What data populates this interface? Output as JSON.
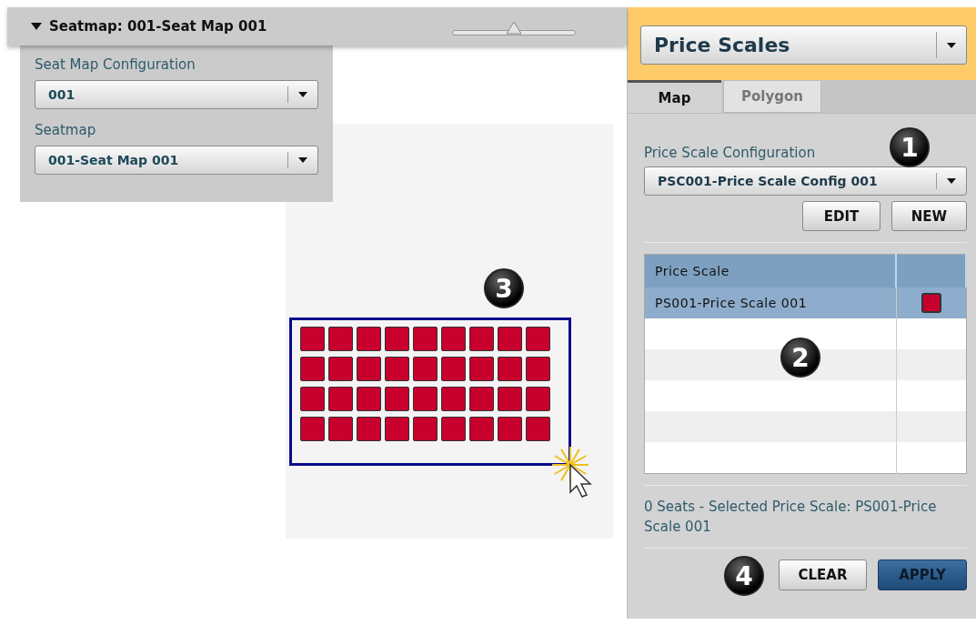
{
  "seatmap_bar": {
    "title": "Seatmap: 001-Seat Map 001",
    "expanded": true,
    "zoom_slider": {
      "level": 0.5
    }
  },
  "seatmap_settings": {
    "fields": [
      {
        "label": "Seat Map Configuration",
        "value": "001"
      },
      {
        "label": "Seatmap",
        "value": "001-Seat Map 001"
      }
    ]
  },
  "seat_map": {
    "callout": "3",
    "seat_rows": [
      {
        "seats": [
          {
            "color": "#c8002e"
          },
          {
            "color": "#c8002e"
          },
          {
            "color": "#c8002e"
          },
          {
            "color": "#c8002e"
          },
          {
            "color": "#c8002e"
          },
          {
            "color": "#c8002e"
          },
          {
            "color": "#c8002e"
          },
          {
            "color": "#c8002e"
          },
          {
            "color": "#c8002e"
          }
        ]
      },
      {
        "seats": [
          {
            "color": "#c8002e"
          },
          {
            "color": "#c8002e"
          },
          {
            "color": "#c8002e"
          },
          {
            "color": "#c8002e"
          },
          {
            "color": "#c8002e"
          },
          {
            "color": "#c8002e"
          },
          {
            "color": "#c8002e"
          },
          {
            "color": "#c8002e"
          },
          {
            "color": "#c8002e"
          }
        ]
      },
      {
        "seats": [
          {
            "color": "#c8002e"
          },
          {
            "color": "#c8002e"
          },
          {
            "color": "#c8002e"
          },
          {
            "color": "#c8002e"
          },
          {
            "color": "#c8002e"
          },
          {
            "color": "#c8002e"
          },
          {
            "color": "#c8002e"
          },
          {
            "color": "#c8002e"
          },
          {
            "color": "#c8002e"
          }
        ]
      },
      {
        "seats": [
          {
            "color": "#c8002e"
          },
          {
            "color": "#c8002e"
          },
          {
            "color": "#c8002e"
          },
          {
            "color": "#c8002e"
          },
          {
            "color": "#c8002e"
          },
          {
            "color": "#c8002e"
          },
          {
            "color": "#c8002e"
          },
          {
            "color": "#c8002e"
          },
          {
            "color": "#c8002e"
          }
        ]
      }
    ]
  },
  "panel": {
    "title": "Price Scales"
  },
  "tabs": [
    {
      "label": "Map",
      "selected": true
    },
    {
      "label": "Polygon",
      "selected": false
    }
  ],
  "price_scale_configuration": {
    "label": "Price Scale Configuration",
    "value": "PSC001-Price Scale Config 001",
    "callout": "1",
    "buttons": [
      "EDIT",
      "NEW"
    ]
  },
  "price_scale_table": {
    "columns": [
      "Price Scale"
    ],
    "callout": "2",
    "rows": [
      {
        "name": "PS001-Price Scale 001",
        "color": "#c8002e",
        "selected": true
      }
    ]
  },
  "status": "0 Seats - Selected Price Scale: PS001-Price Scale 001",
  "footer": {
    "callout": "4",
    "buttons": [
      {
        "label": "CLEAR",
        "kind": "secondary"
      },
      {
        "label": "APPLY",
        "kind": "primary"
      }
    ]
  }
}
